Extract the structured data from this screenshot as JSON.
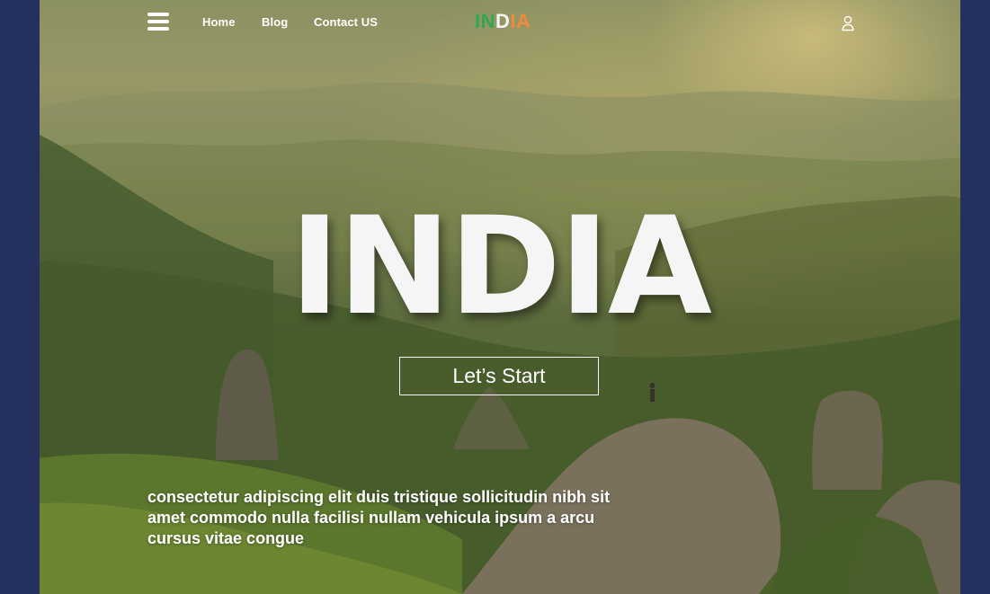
{
  "nav": {
    "links": [
      "Home",
      "Blog",
      "Contact US"
    ],
    "logo": {
      "part1": "IN",
      "part2": "D",
      "part3": "IA"
    }
  },
  "hero": {
    "title": "INDIA",
    "cta_label": "Let’s Start",
    "tagline": "consectetur adipiscing elit duis tristique sollicitudin nibh sit amet commodo nulla facilisi nullam vehicula ipsum a arcu cursus vitae congue"
  },
  "icons": {
    "menu": "hamburger-menu-icon",
    "user": "user-icon"
  },
  "colors": {
    "page_background": "#24305e",
    "logo_green": "#2fa84f",
    "logo_white": "#f4f4f4",
    "logo_orange": "#f08a3a"
  }
}
